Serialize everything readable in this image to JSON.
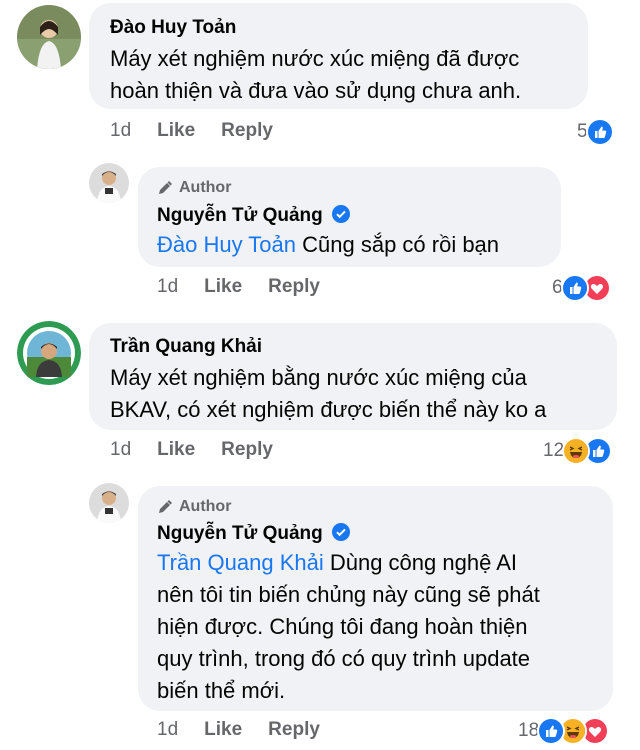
{
  "comments": [
    {
      "author": "Đào Huy Toản",
      "text": "Máy xét nghiệm nước xúc miệng đã được hoàn thiện và đưa vào sử dụng chưa anh.",
      "text_lines": [
        "Máy xét nghiệm nước xúc miệng đã được",
        "hoàn thiện và đưa vào sử dụng chưa anh."
      ],
      "time": "1d",
      "like": "Like",
      "reply": "Reply",
      "reaction_count": "5",
      "reactions": [
        "like-icon"
      ]
    },
    {
      "is_reply": true,
      "badge": "Author",
      "author": "Nguyễn Tử Quảng",
      "verified": true,
      "mention": "Đào Huy Toản",
      "text": " Cũng sắp có rồi bạn",
      "time": "1d",
      "like": "Like",
      "reply": "Reply",
      "reaction_count": "6",
      "reactions": [
        "like-icon",
        "love-icon"
      ]
    },
    {
      "author": "Trần Quang Khải",
      "text_lines": [
        "Máy xét nghiệm bằng nước xúc miệng của",
        "BKAV, có xét nghiệm được biến thể này ko a"
      ],
      "time": "1d",
      "like": "Like",
      "reply": "Reply",
      "reaction_count": "12",
      "reactions": [
        "haha-icon",
        "like-icon"
      ]
    },
    {
      "is_reply": true,
      "badge": "Author",
      "author": "Nguyễn Tử Quảng",
      "verified": true,
      "mention": "Trần Quang Khải",
      "text_first": " Dùng công nghệ AI",
      "text_lines": [
        "nên tôi tin biến chủng này cũng sẽ phát",
        "hiện được. Chúng tôi đang hoàn thiện",
        "quy trình, trong đó có quy trình update",
        "biến thể mới."
      ],
      "time": "1d",
      "like": "Like",
      "reply": "Reply",
      "reaction_count": "18",
      "reactions": [
        "like-icon",
        "haha-icon",
        "love-icon"
      ]
    }
  ],
  "colors": {
    "bubble": "#f0f2f5",
    "mention": "#1877f2",
    "meta": "#65676b",
    "like_blue": "#1877f2",
    "love_red": "#f33e58",
    "haha_yellow": "#f7b125"
  }
}
